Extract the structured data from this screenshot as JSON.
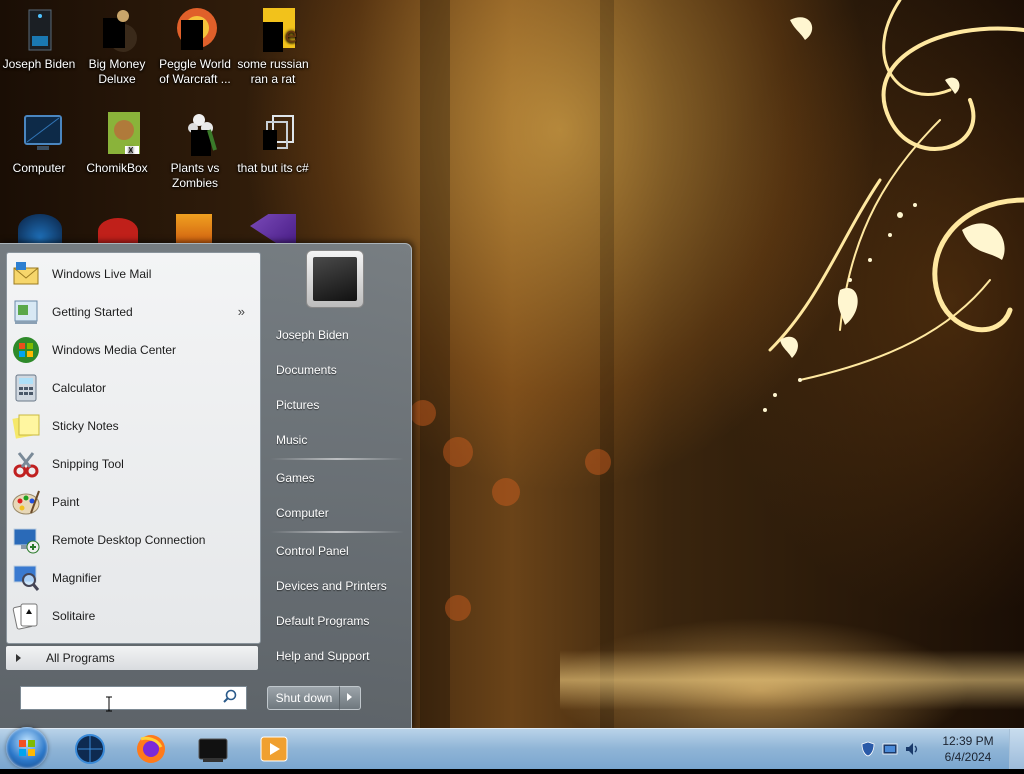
{
  "desktop": {
    "icons": [
      {
        "label": "Joseph Biden"
      },
      {
        "label": "Big Money Deluxe"
      },
      {
        "label": "Peggle World of Warcraft ..."
      },
      {
        "label": "some russian ran a rat"
      },
      {
        "label": "Computer"
      },
      {
        "label": "ChomikBox"
      },
      {
        "label": "Plants vs Zombies"
      },
      {
        "label": "that but its c#"
      }
    ]
  },
  "start_menu": {
    "programs": [
      {
        "label": "Windows Live Mail",
        "icon": "mail-icon"
      },
      {
        "label": "Getting Started",
        "icon": "getting-started-icon",
        "submenu_glyph": "»"
      },
      {
        "label": "Windows Media Center",
        "icon": "media-center-icon"
      },
      {
        "label": "Calculator",
        "icon": "calculator-icon"
      },
      {
        "label": "Sticky Notes",
        "icon": "sticky-notes-icon"
      },
      {
        "label": "Snipping Tool",
        "icon": "scissors-icon"
      },
      {
        "label": "Paint",
        "icon": "palette-icon"
      },
      {
        "label": "Remote Desktop Connection",
        "icon": "remote-desktop-icon"
      },
      {
        "label": "Magnifier",
        "icon": "magnifier-icon"
      },
      {
        "label": "Solitaire",
        "icon": "cards-icon"
      }
    ],
    "all_programs": "All Programs",
    "search": {
      "value": "",
      "placeholder": ""
    },
    "right_items": [
      {
        "label": "Joseph Biden"
      },
      {
        "label": "Documents"
      },
      {
        "label": "Pictures"
      },
      {
        "label": "Music"
      },
      {
        "label": "Games"
      },
      {
        "label": "Computer"
      },
      {
        "label": "Control Panel"
      },
      {
        "label": "Devices and Printers"
      },
      {
        "label": "Default Programs"
      },
      {
        "label": "Help and Support"
      }
    ],
    "shutdown_label": "Shut down"
  },
  "taskbar": {
    "pinned": [
      "globe-icon",
      "firefox-icon",
      "media-center-icon",
      "media-player-icon"
    ],
    "clock": {
      "time": "12:39 PM",
      "date": "6/4/2024"
    }
  },
  "colors": {
    "taskbar": "#8fb4d6",
    "start_menu": "#6f787e",
    "left_pane": "#eceeef"
  }
}
